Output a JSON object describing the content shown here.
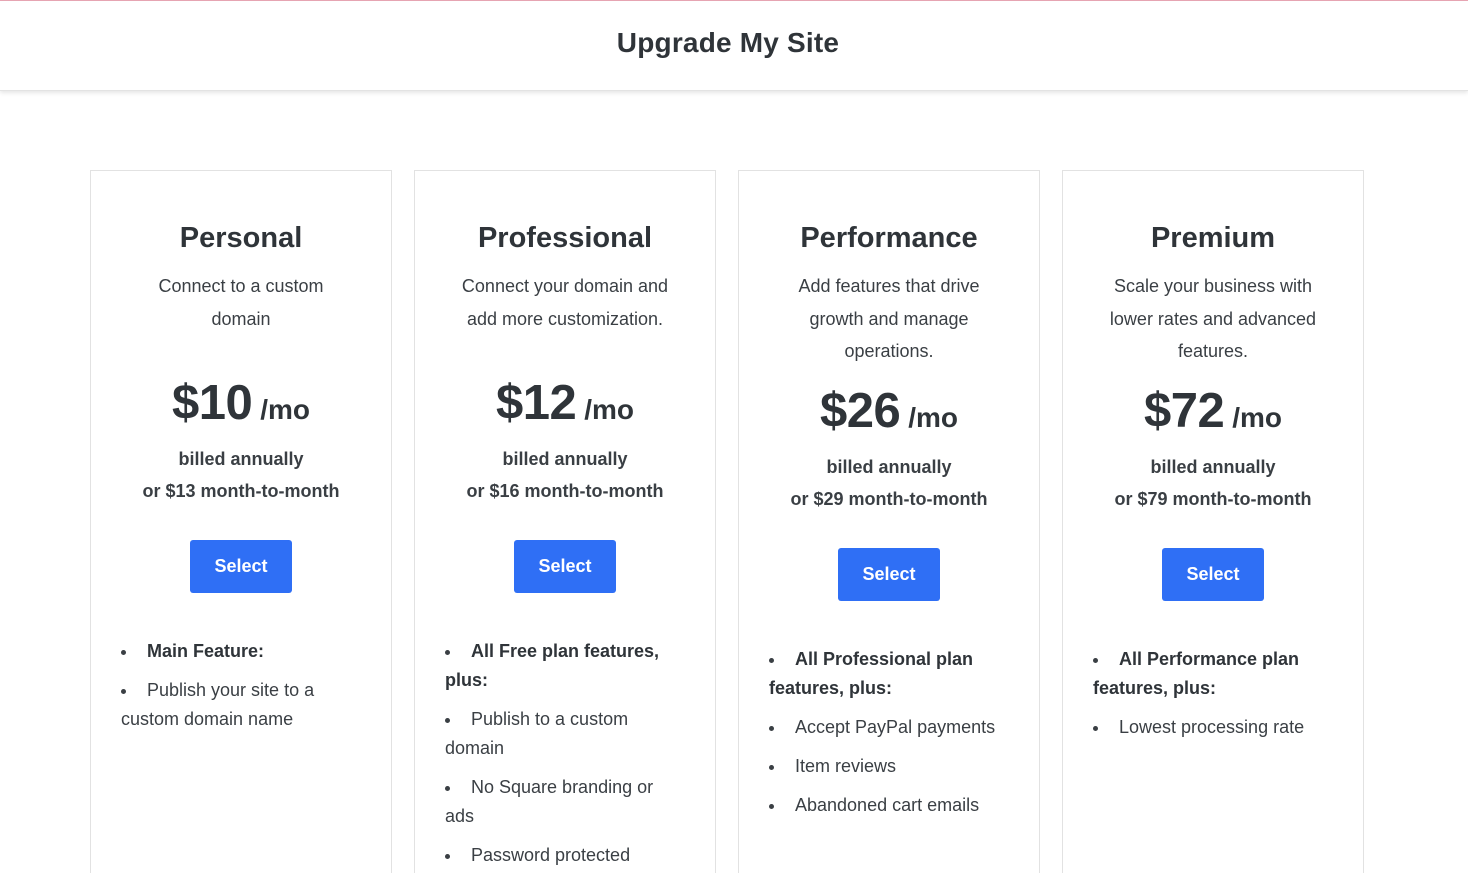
{
  "header": {
    "title": "Upgrade My Site"
  },
  "plans": [
    {
      "name": "Personal",
      "description": "Connect to a custom domain",
      "price": "$10",
      "unit": "/mo",
      "billing_line1": "billed annually",
      "billing_line2": "or $13 month-to-month",
      "select_label": "Select",
      "features": [
        {
          "text": "Main Feature:",
          "bold": true
        },
        {
          "text": "Publish your site to a custom domain name",
          "bold": false
        }
      ]
    },
    {
      "name": "Professional",
      "description": "Connect your domain and add more customization.",
      "price": "$12",
      "unit": "/mo",
      "billing_line1": "billed annually",
      "billing_line2": "or $16 month-to-month",
      "select_label": "Select",
      "features": [
        {
          "text": "All Free plan features, plus:",
          "bold": true
        },
        {
          "text": "Publish to a custom domain",
          "bold": false
        },
        {
          "text": "No Square branding or ads",
          "bold": false
        },
        {
          "text": "Password protected",
          "bold": false
        }
      ]
    },
    {
      "name": "Performance",
      "description": "Add features that drive growth and manage operations.",
      "price": "$26",
      "unit": "/mo",
      "billing_line1": "billed annually",
      "billing_line2": "or $29 month-to-month",
      "select_label": "Select",
      "features": [
        {
          "text": "All Professional plan features, plus:",
          "bold": true
        },
        {
          "text": "Accept PayPal payments",
          "bold": false
        },
        {
          "text": "Item reviews",
          "bold": false
        },
        {
          "text": "Abandoned cart emails",
          "bold": false
        }
      ]
    },
    {
      "name": "Premium",
      "description": "Scale your business with lower rates and advanced features.",
      "price": "$72",
      "unit": "/mo",
      "billing_line1": "billed annually",
      "billing_line2": "or $79 month-to-month",
      "select_label": "Select",
      "features": [
        {
          "text": "All Performance plan features, plus:",
          "bold": true
        },
        {
          "text": "Lowest processing rate",
          "bold": false
        }
      ]
    }
  ],
  "colors": {
    "accent": "#2f6ff5",
    "top_border": "#e9a6b4",
    "heading": "#2f3439",
    "body_text": "#3a3f44"
  }
}
